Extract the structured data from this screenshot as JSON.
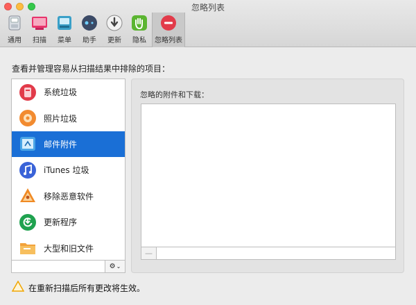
{
  "window": {
    "title": "忽略列表"
  },
  "toolbar": {
    "items": [
      {
        "label": "通用",
        "icon": "general-icon"
      },
      {
        "label": "扫描",
        "icon": "scan-icon"
      },
      {
        "label": "菜单",
        "icon": "menu-icon"
      },
      {
        "label": "助手",
        "icon": "assistant-icon"
      },
      {
        "label": "更新",
        "icon": "update-icon"
      },
      {
        "label": "隐私",
        "icon": "privacy-hand-icon"
      },
      {
        "label": "忽略列表",
        "icon": "ignore-list-icon"
      }
    ],
    "active_index": 6
  },
  "instruction": "查看并管理容易从扫描结果中排除的项目：",
  "list": {
    "items": [
      {
        "label": "系统垃圾",
        "icon": "system-junk-icon"
      },
      {
        "label": "照片垃圾",
        "icon": "photo-junk-icon"
      },
      {
        "label": "邮件附件",
        "icon": "mail-attachments-icon"
      },
      {
        "label": "iTunes 垃圾",
        "icon": "itunes-junk-icon"
      },
      {
        "label": "移除恶意软件",
        "icon": "malware-removal-icon"
      },
      {
        "label": "更新程序",
        "icon": "updater-icon"
      },
      {
        "label": "大型和旧文件",
        "icon": "large-old-files-icon"
      }
    ],
    "selected_index": 2
  },
  "panel": {
    "title": "忽略的附件和下载：",
    "remove_label": "—"
  },
  "footer": {
    "warning_text": "在重新扫描后所有更改将生效。"
  },
  "colors": {
    "selection": "#1a6fd6",
    "window_bg": "#ececec",
    "warning": "#f0a500"
  }
}
